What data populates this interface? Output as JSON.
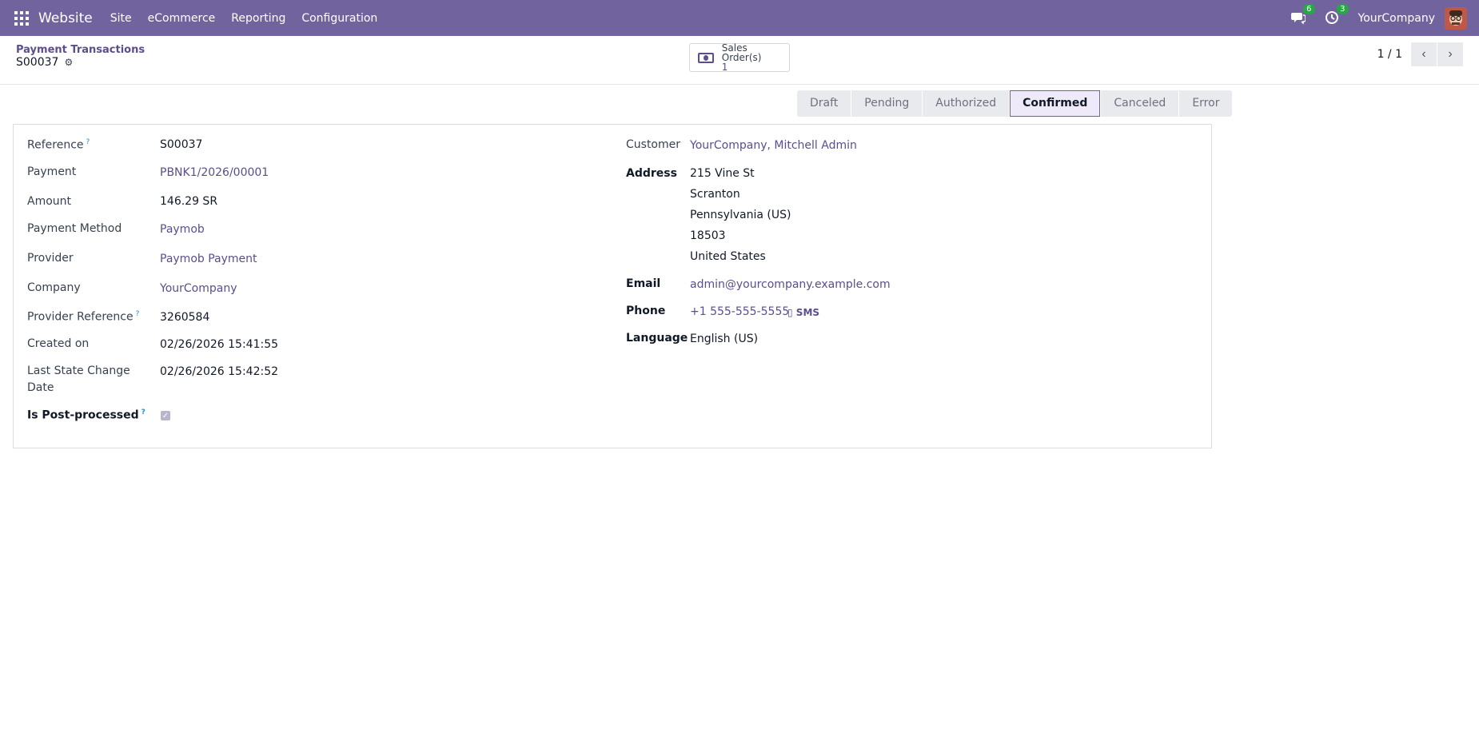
{
  "navbar": {
    "app_name": "Website",
    "menu": [
      "Site",
      "eCommerce",
      "Reporting",
      "Configuration"
    ],
    "messages_count": "6",
    "activities_count": "3",
    "company": "YourCompany"
  },
  "control_panel": {
    "breadcrumb": "Payment Transactions",
    "record_name": "S00037",
    "smart_button": {
      "label": "Sales Order(s)",
      "value": "1"
    },
    "pager": "1 / 1"
  },
  "statusbar": {
    "stages": [
      "Draft",
      "Pending",
      "Authorized",
      "Confirmed",
      "Canceled",
      "Error"
    ],
    "active": "Confirmed"
  },
  "left_fields": {
    "reference": {
      "label": "Reference",
      "value": "S00037"
    },
    "payment": {
      "label": "Payment",
      "value": "PBNK1/2026/00001"
    },
    "amount": {
      "label": "Amount",
      "value": "146.29 SR"
    },
    "payment_method": {
      "label": "Payment Method",
      "value": "Paymob"
    },
    "provider": {
      "label": "Provider",
      "value": "Paymob Payment"
    },
    "company": {
      "label": "Company",
      "value": "YourCompany"
    },
    "provider_reference": {
      "label": "Provider Reference",
      "value": "3260584"
    },
    "created_on": {
      "label": "Created on",
      "value": "02/26/2026 15:41:55"
    },
    "last_state_change_line1": "Last State Change",
    "last_state_change_line2": "Date",
    "last_state_change_value": "02/26/2026 15:42:52",
    "is_post_processed": {
      "label": "Is Post-processed",
      "checked": true
    }
  },
  "right_fields": {
    "customer": {
      "label": "Customer",
      "value": "YourCompany, Mitchell Admin"
    },
    "address": {
      "label": "Address",
      "lines": [
        "215 Vine St",
        "Scranton",
        "Pennsylvania (US)",
        "18503",
        "United States"
      ]
    },
    "email": {
      "label": "Email",
      "value": "admin@yourcompany.example.com"
    },
    "phone": {
      "label": "Phone",
      "value": "+1 555-555-5555",
      "sms": "SMS"
    },
    "language": {
      "label": "Language",
      "value": "English (US)"
    }
  },
  "colors": {
    "navbar": "#71639e",
    "link": "#5b4d8f",
    "badge": "#28a745"
  }
}
